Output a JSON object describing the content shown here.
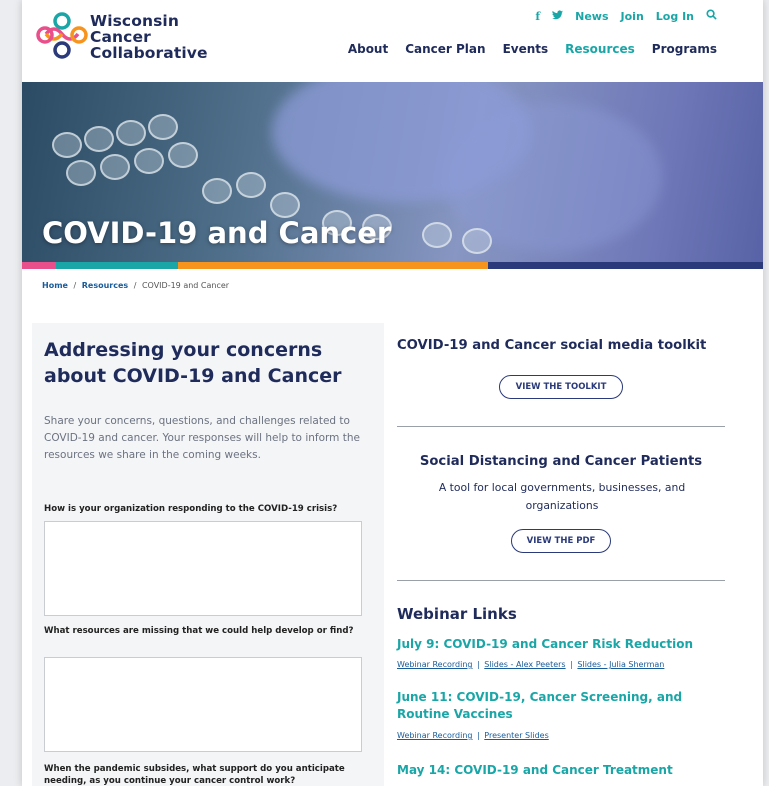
{
  "brand": {
    "line1": "Wisconsin",
    "line2": "Cancer",
    "line3": "Collaborative",
    "colors": {
      "navy": "#1f2b5a",
      "teal": "#1aa6a7",
      "pink": "#e94f8a",
      "orange": "#f7941d",
      "blue": "#2a3a7a"
    }
  },
  "util_nav": {
    "news": "News",
    "join": "Join",
    "login": "Log In",
    "facebook_icon": "facebook-icon",
    "twitter_icon": "twitter-icon",
    "search_icon": "search-icon"
  },
  "main_nav": {
    "about": "About",
    "cancer_plan": "Cancer Plan",
    "events": "Events",
    "resources": "Resources",
    "programs": "Programs"
  },
  "hero": {
    "title": "COVID-19 and Cancer"
  },
  "breadcrumb": {
    "home": "Home",
    "resources": "Resources",
    "current": "COVID-19 and Cancer",
    "sep": "/"
  },
  "form": {
    "title": "Addressing your concerns about COVID-19 and Cancer",
    "intro": "Share your concerns, questions, and challenges related to COVID-19 and cancer. Your responses will help to inform the resources we share in the coming weeks.",
    "q1": "How is your organization responding to the COVID-19 crisis?",
    "q2": "What resources are missing that we could help develop or find?",
    "q3": "When the pandemic subsides, what support do you anticipate needing, as you continue your cancer control work?"
  },
  "right": {
    "toolkit_title": "COVID-19 and Cancer social media toolkit",
    "toolkit_btn": "VIEW THE TOOLKIT",
    "distancing_title": "Social Distancing and Cancer Patients",
    "distancing_desc": "A tool for local governments, businesses, and organizations",
    "distancing_btn": "VIEW THE PDF",
    "webinar_heading": "Webinar Links",
    "webinars": [
      {
        "title": "July 9: COVID-19 and Cancer Risk Reduction",
        "links": [
          "Webinar Recording",
          "Slides - Alex Peeters",
          "Slides - Julia Sherman"
        ]
      },
      {
        "title": "June 11: COVID-19, Cancer Screening, and Routine Vaccines",
        "links": [
          "Webinar Recording",
          "Presenter Slides"
        ]
      },
      {
        "title": "May 14: COVID-19 and Cancer Treatment",
        "links": []
      }
    ],
    "link_sep": "|"
  }
}
